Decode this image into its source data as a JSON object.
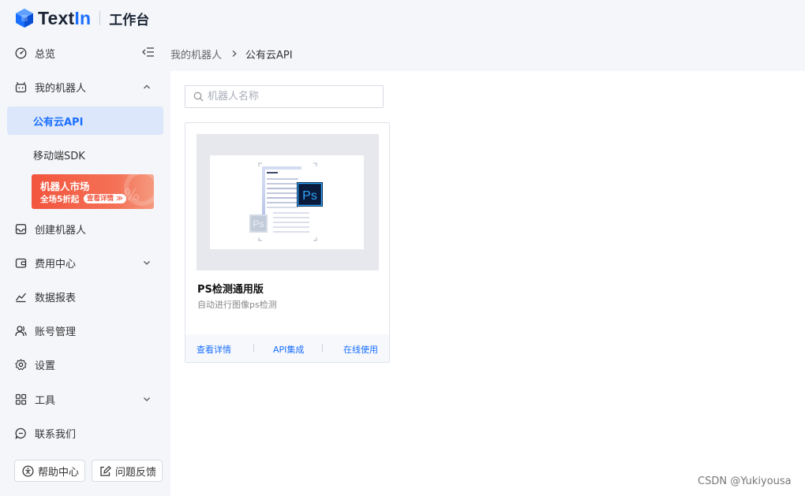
{
  "header": {
    "brand_prefix": "Text",
    "brand_suffix": "In",
    "workspace_title": "工作台"
  },
  "sidebar": {
    "overview": "总览",
    "my_robots": "我的机器人",
    "robot_items": [
      "公有云API",
      "移动端SDK"
    ],
    "promo": {
      "title": "机器人市场",
      "subtitle": "全场5折起",
      "button": "查看详情 ≫"
    },
    "create_robot": "创建机器人",
    "billing": "费用中心",
    "reports": "数据报表",
    "account": "账号管理",
    "settings": "设置",
    "tools": "工具",
    "contact": "联系我们",
    "help_button": "帮助中心",
    "feedback_button": "问题反馈"
  },
  "breadcrumb": {
    "parent": "我的机器人",
    "current": "公有云API"
  },
  "search": {
    "placeholder": "机器人名称",
    "value": ""
  },
  "card": {
    "title": "PS检测通用版",
    "description": "自动进行图像ps检测",
    "actions": [
      "查看详情",
      "API集成",
      "在线使用"
    ]
  },
  "watermark": "CSDN @Yukiyousa",
  "colors": {
    "accent": "#1a6fff",
    "active_bg": "#dde7fb",
    "promo": "#f2553e"
  }
}
